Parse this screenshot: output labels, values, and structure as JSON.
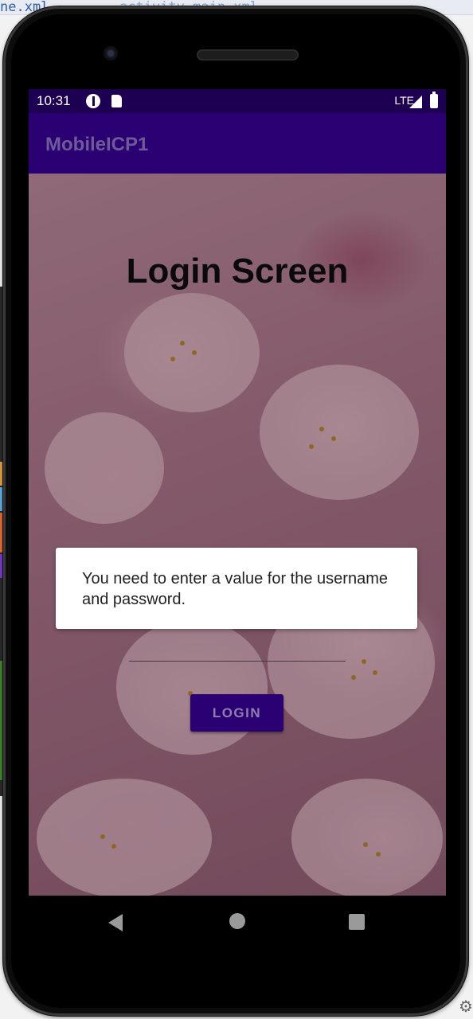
{
  "ide": {
    "tab1": "ne.xml",
    "tab2": "activity_main.xml"
  },
  "statusbar": {
    "time": "10:31",
    "network": "LTE",
    "icons": [
      "data-saver-icon",
      "sd-card-icon",
      "signal-icon",
      "battery-icon"
    ]
  },
  "appbar": {
    "title": "MobileICP1",
    "background": "#2a0072"
  },
  "main": {
    "title": "Login Screen",
    "login_button": "LOGIN"
  },
  "toast": {
    "message": "You need to enter a value for the username and password."
  },
  "navbar": {
    "icons": [
      "back-icon",
      "home-icon",
      "recents-icon"
    ]
  }
}
